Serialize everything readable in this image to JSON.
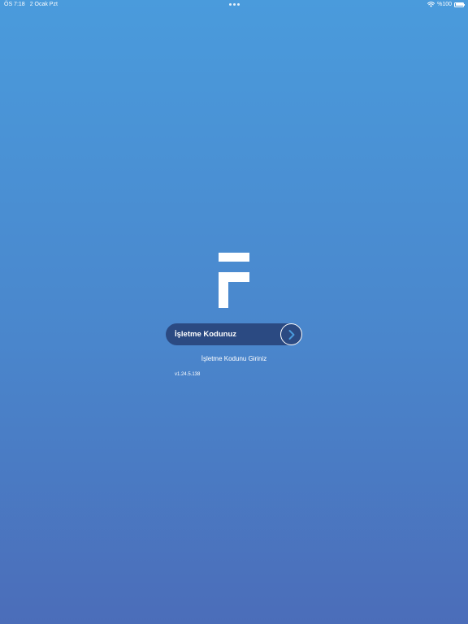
{
  "status_bar": {
    "time": "ÖS 7:18",
    "date": "2 Ocak Pzt",
    "battery": "%100",
    "icons": [
      "wifi-icon",
      "battery-icon"
    ]
  },
  "brand": {
    "logo_icon": "f-logo-icon",
    "color": "#ffffff"
  },
  "login": {
    "code_placeholder": "İşletme Kodunuz",
    "code_value": "",
    "go_icon": "chevron-right-icon",
    "hint": "İşletme Kodunu Giriniz"
  },
  "version": "v1.24.5.138",
  "colors": {
    "background_top": "#4a9bdc",
    "background_bottom": "#4b6db9",
    "pill": "#2b4a82",
    "chevron": "#4a9bdc"
  }
}
